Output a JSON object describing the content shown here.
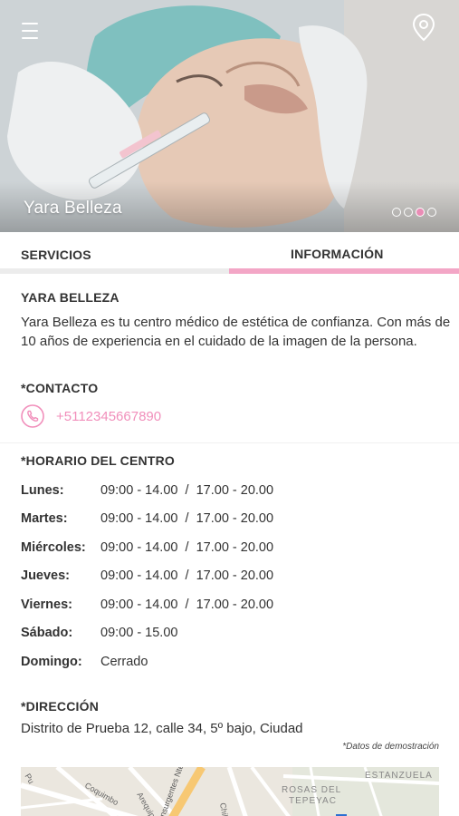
{
  "hero": {
    "title": "Yara Belleza",
    "menu_icon": "hamburger-menu-icon",
    "location_icon": "map-pin-icon",
    "slides": [
      {
        "active": false
      },
      {
        "active": false
      },
      {
        "active": true
      },
      {
        "active": false
      }
    ]
  },
  "tabs": {
    "servicios": "SERVICIOS",
    "informacion": "INFORMACIÓN",
    "active": "informacion"
  },
  "info": {
    "name_title": "YARA BELLEZA",
    "description": "Yara Belleza es tu centro médico de estética de confianza. Con más de 10 años de experiencia en el cuidado de la imagen de la persona.",
    "contact_title": "*CONTACTO",
    "phone": "+5112345667890",
    "hours_title": "*HORARIO DEL CENTRO",
    "hours": [
      {
        "day": "Lunes:",
        "value": "09:00 - 14.00  /  17.00 - 20.00"
      },
      {
        "day": "Martes:",
        "value": "09:00 - 14.00  /  17.00 - 20.00"
      },
      {
        "day": "Miércoles:",
        "value": "09:00 - 14.00  /  17.00 - 20.00"
      },
      {
        "day": "Jueves:",
        "value": "09:00 - 14.00  /  17.00 - 20.00"
      },
      {
        "day": "Viernes:",
        "value": "09:00 - 14.00  /  17.00 - 20.00"
      },
      {
        "day": "Sábado:",
        "value": "09:00 - 15.00"
      },
      {
        "day": "Domingo:",
        "value": "Cerrado"
      }
    ],
    "address_title": "*DIRECCIÓN",
    "address": "Distrito de Prueba 12, calle 34, 5º bajo, Ciudad",
    "demo_note": "*Datos de demostración"
  },
  "map": {
    "labels": [
      "ESTANZUELA",
      "ROSAS DEL",
      "TEPEYAC",
      "Coquimbo",
      "Arequipa",
      "Insurgentes Nte",
      "Chihu",
      "Pu"
    ]
  },
  "colors": {
    "accent_pink": "#f18fbb",
    "tab_underline_active": "#f3a6c6",
    "tab_underline_inactive": "#ececec",
    "text": "#333333"
  }
}
